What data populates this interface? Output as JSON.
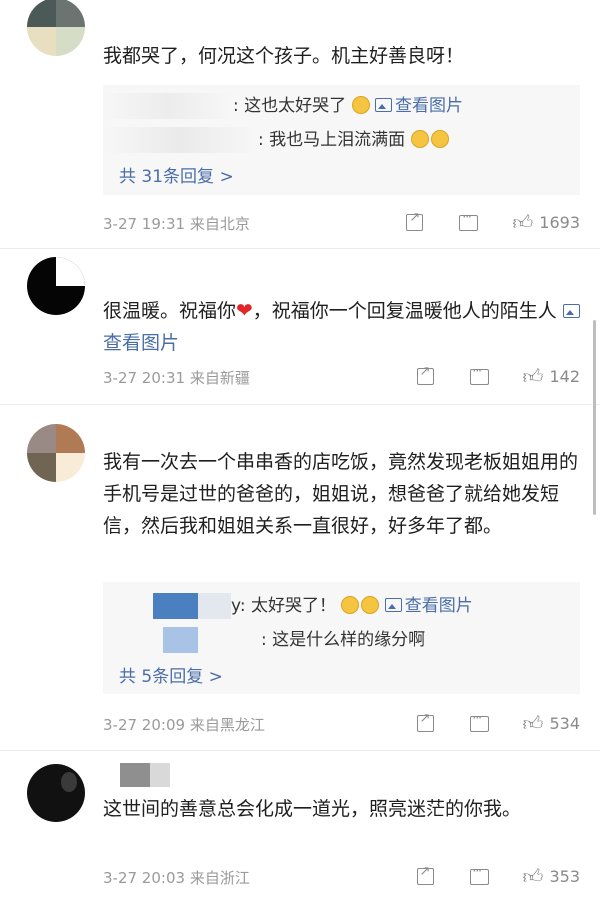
{
  "comments": [
    {
      "text": "我都哭了，何况这个孩子。机主好善良呀！",
      "replies": [
        {
          "text": ": 这也太好哭了",
          "link": "查看图片"
        },
        {
          "text": ": 我也马上泪流满面"
        }
      ],
      "more": "共 31条回复 >",
      "time": "3-27 19:31",
      "loc": "来自北京",
      "likes": "1693"
    },
    {
      "text_a": "很温暖。祝福你",
      "text_b": "，祝福你一个回复温暖他人的陌生人",
      "link": "查看图片",
      "time": "3-27 20:31",
      "loc": "来自新疆",
      "likes": "142"
    },
    {
      "text": "我有一次去一个串串香的店吃饭，竟然发现老板姐姐用的手机号是过世的爸爸的，姐姐说，想爸爸了就给她发短信，然后我和姐姐关系一直很好，好多年了都。",
      "replies": [
        {
          "text": "y: 太好哭了！",
          "link": "查看图片"
        },
        {
          "text": ": 这是什么样的缘分啊"
        }
      ],
      "more": "共 5条回复 >",
      "time": "3-27 20:09",
      "loc": "来自黑龙江",
      "likes": "534"
    },
    {
      "text": "这世间的善意总会化成一道光，照亮迷茫的你我。",
      "time": "3-27 20:03",
      "loc": "来自浙江",
      "likes": "353"
    }
  ],
  "icons": {
    "share": "share-icon",
    "comment": "comment-icon",
    "like": "thumbs-up-icon",
    "picture": "picture-icon"
  },
  "colors": {
    "link": "#4a6ea9",
    "meta": "#9a9a9a",
    "reply_bg": "#f7f7f7"
  }
}
